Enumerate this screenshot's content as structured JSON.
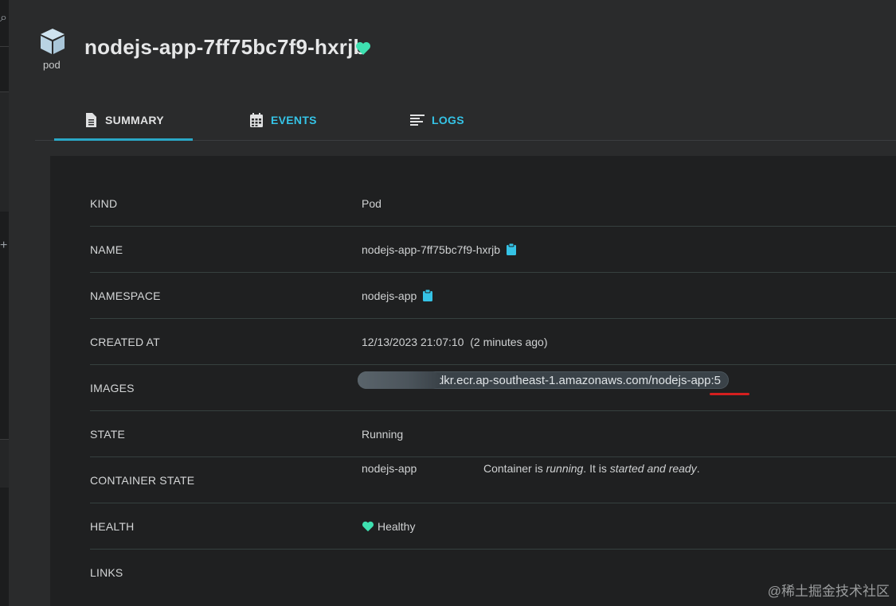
{
  "header": {
    "kind_label": "pod",
    "title": "nodejs-app-7ff75bc7f9-hxrjb"
  },
  "tabs": [
    {
      "label": "SUMMARY",
      "icon": "document-icon"
    },
    {
      "label": "EVENTS",
      "icon": "calendar-icon"
    },
    {
      "label": "LOGS",
      "icon": "lines-icon"
    }
  ],
  "summary": {
    "rows": [
      {
        "key": "KIND",
        "value": "Pod"
      },
      {
        "key": "NAME",
        "value": "nodejs-app-7ff75bc7f9-hxrjb"
      },
      {
        "key": "NAMESPACE",
        "value": "nodejs-app"
      },
      {
        "key": "CREATED AT",
        "value": "12/13/2023 21:07:10  (2 minutes ago)"
      },
      {
        "key": "IMAGES",
        "value": ".dkr.ecr.ap-southeast-1.amazonaws.com/nodejs-app:5"
      },
      {
        "key": "STATE",
        "value": "Running"
      },
      {
        "key": "CONTAINER STATE",
        "container": "nodejs-app",
        "desc_prefix": "Container is ",
        "desc_em1": "running",
        "desc_mid": ". It is ",
        "desc_em2": "started and ready",
        "desc_suffix": "."
      },
      {
        "key": "HEALTH",
        "value": "Healthy"
      },
      {
        "key": "LINKS",
        "value": ""
      }
    ]
  },
  "watermark": "@稀土掘金技术社区",
  "colors": {
    "accent": "#35c3e6",
    "healthy": "#3ee0b0",
    "underline": "#d41f1f"
  }
}
